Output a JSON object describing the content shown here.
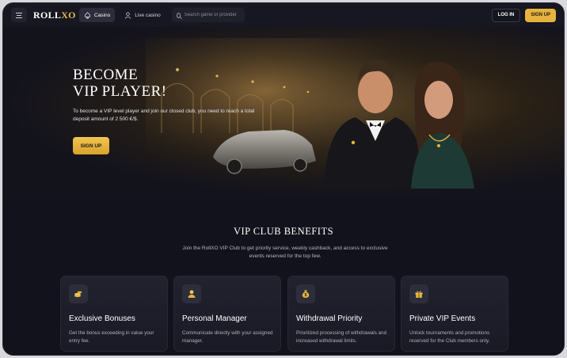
{
  "header": {
    "logo_main": "ROLL",
    "logo_accent": "XO",
    "tabs": [
      {
        "label": "Casino",
        "icon": "spade-icon"
      },
      {
        "label": "Live casino",
        "icon": "dealer-icon"
      }
    ],
    "search_placeholder": "Search game or provider",
    "login_label": "LOG IN",
    "signup_label": "SIGN UP"
  },
  "hero": {
    "title_line1": "BECOME",
    "title_line2": "VIP PLAYER!",
    "text": "To become a VIP level player and join our closed club, you need to reach a total deposit amount of 2 500 €/$.",
    "button_label": "SIGN UP"
  },
  "vip": {
    "title": "VIP CLUB BENEFITS",
    "description": "Join the RollXO VIP Club to get priority service, weekly cashback, and access to exclusive events reserved for the top few.",
    "cards": [
      {
        "title": "Exclusive Bonuses",
        "text": "Get the bonus exceeding in value your entry fee.",
        "icon": "coins-icon"
      },
      {
        "title": "Personal Manager",
        "text": "Communicate directly with your assigned manager.",
        "icon": "manager-icon"
      },
      {
        "title": "Withdrawal Priority",
        "text": "Prioritized processing of withdrawals and increased withdrawal limits.",
        "icon": "money-bag-icon"
      },
      {
        "title": "Private VIP Events",
        "text": "Unlock tournaments and promotions reserved for the Club members only.",
        "icon": "gift-icon"
      }
    ]
  },
  "colors": {
    "accent": "#e6b33e",
    "background": "#12121c",
    "card": "#1f1f2b"
  }
}
